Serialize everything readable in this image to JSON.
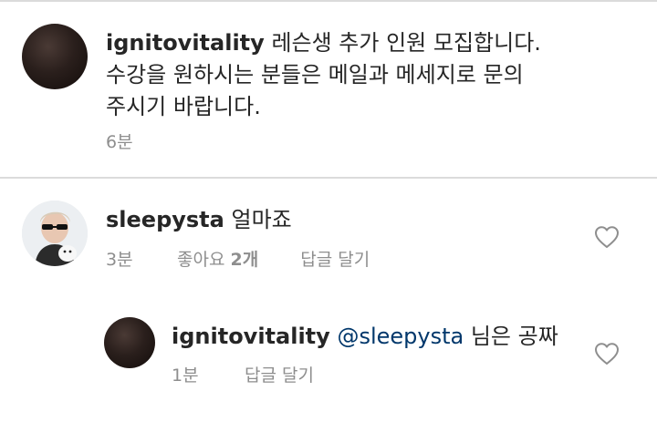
{
  "caption": {
    "username": "ignitovitality",
    "lines": [
      "레슨생 추가 인원 모집합니다.",
      "수강을 원하시는 분들은 메일과 메세지로 문의",
      "주시기 바랍니다."
    ],
    "time": "6분"
  },
  "comments": [
    {
      "username": "sleepysta",
      "text": "얼마죠",
      "time": "3분",
      "likes_label": "좋아요",
      "likes_count": "2개",
      "reply_label": "답글 달기",
      "icon": "heart-outline-icon"
    },
    {
      "username": "ignitovitality",
      "mention": "@sleepysta",
      "text": "님은 공짜",
      "time": "1분",
      "reply_label": "답글 달기",
      "icon": "heart-outline-icon"
    }
  ],
  "colors": {
    "text": "#262626",
    "secondary": "#8e8e8e",
    "mention": "#00376b",
    "divider": "#dbdbdb"
  }
}
